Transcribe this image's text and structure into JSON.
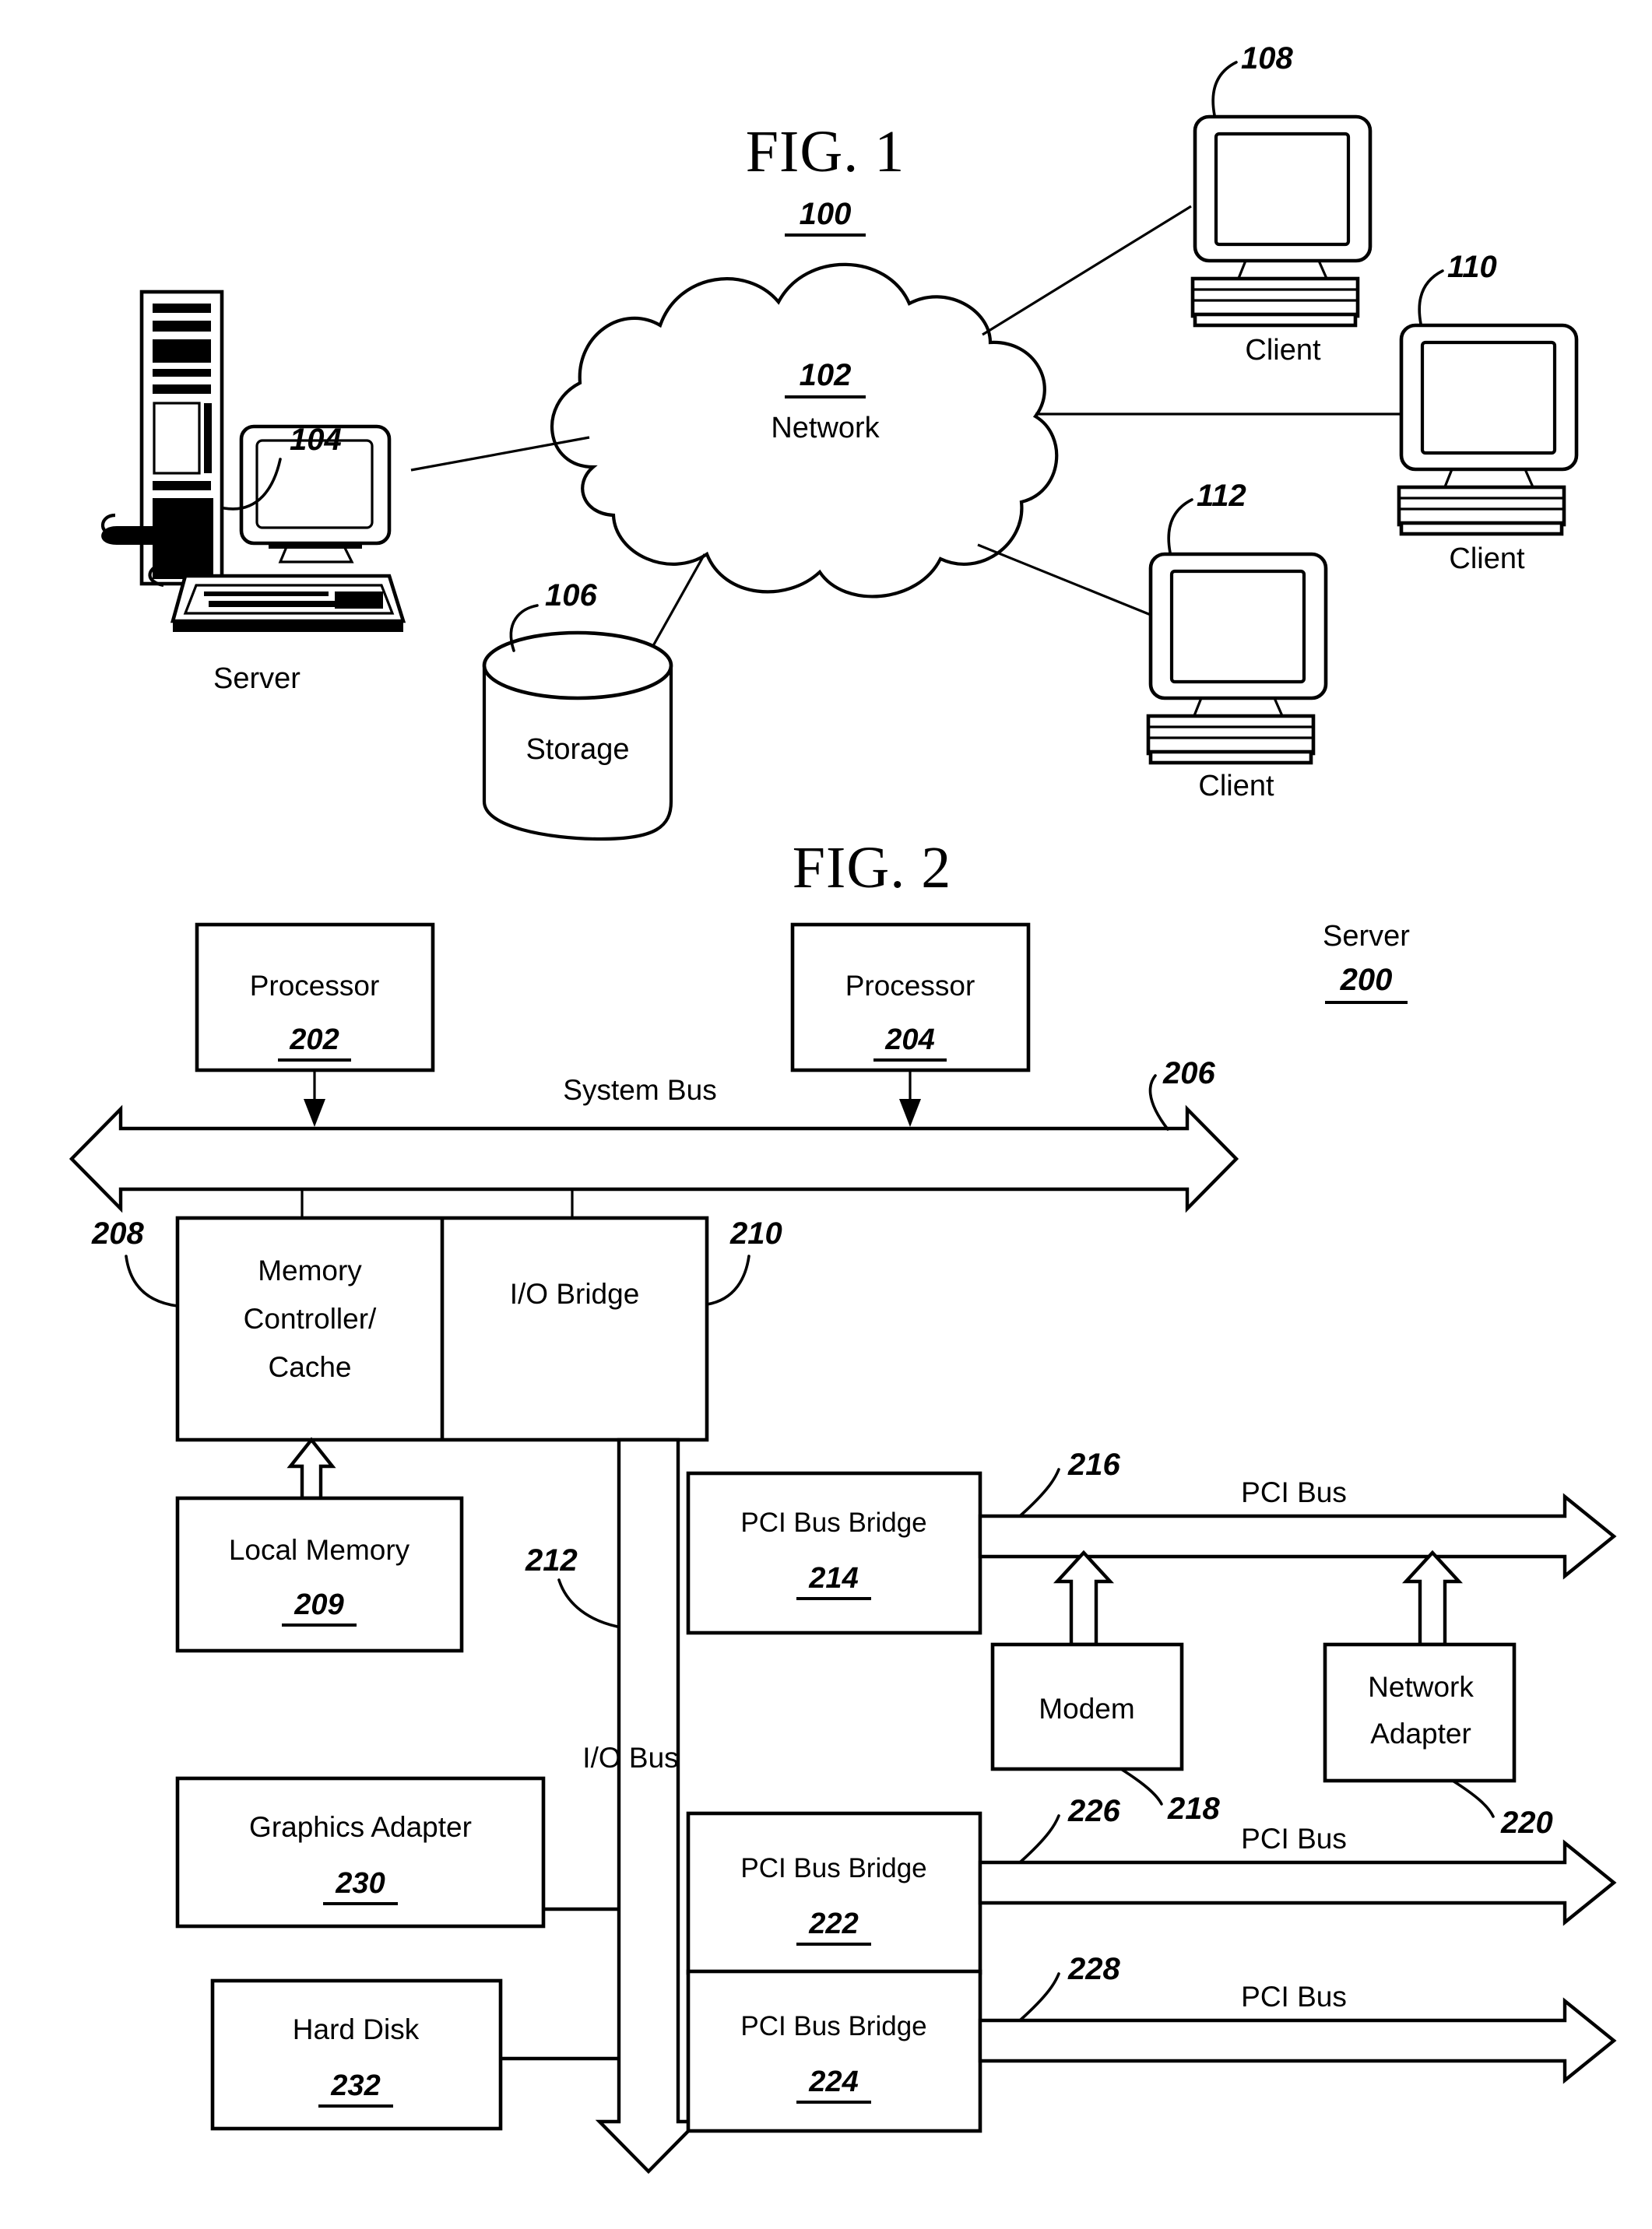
{
  "sheet": {
    "figures": [
      {
        "id": "fig1",
        "title": "FIG. 1",
        "ref": "100"
      },
      {
        "id": "fig2",
        "title": "FIG. 2",
        "ref": "200",
        "ref_label": "Server"
      }
    ]
  },
  "fig1": {
    "title": "FIG. 1",
    "ref": "100",
    "network": {
      "ref": "102",
      "label": "Network"
    },
    "server": {
      "ref": "104",
      "label": "Server"
    },
    "storage": {
      "ref": "106",
      "label": "Storage"
    },
    "clients": [
      {
        "ref": "108",
        "label": "Client"
      },
      {
        "ref": "110",
        "label": "Client"
      },
      {
        "ref": "112",
        "label": "Client"
      }
    ]
  },
  "fig2": {
    "title": "FIG. 2",
    "system_label": "Server",
    "system_ref": "200",
    "blocks": [
      {
        "name": "processor-1",
        "label": "Processor",
        "ref": "202"
      },
      {
        "name": "processor-2",
        "label": "Processor",
        "ref": "204"
      },
      {
        "name": "memory-controller-cache",
        "label_line1": "Memory",
        "label_line2": "Controller/",
        "label_line3": "Cache",
        "ref": "208"
      },
      {
        "name": "io-bridge",
        "label": "I/O Bridge",
        "ref": "210"
      },
      {
        "name": "local-memory",
        "label": "Local Memory",
        "ref": "209"
      },
      {
        "name": "pci-bus-bridge-214",
        "label": "PCI Bus Bridge",
        "ref": "214"
      },
      {
        "name": "modem",
        "label": "Modem",
        "ref": "218"
      },
      {
        "name": "network-adapter",
        "label_line1": "Network",
        "label_line2": "Adapter",
        "ref": "220"
      },
      {
        "name": "graphics-adapter",
        "label": "Graphics Adapter",
        "ref": "230"
      },
      {
        "name": "hard-disk",
        "label": "Hard Disk",
        "ref": "232"
      },
      {
        "name": "pci-bus-bridge-222",
        "label": "PCI Bus Bridge",
        "ref": "222"
      },
      {
        "name": "pci-bus-bridge-224",
        "label": "PCI Bus Bridge",
        "ref": "224"
      }
    ],
    "buses": [
      {
        "name": "system-bus",
        "label": "System Bus",
        "ref": "206"
      },
      {
        "name": "io-bus",
        "label": "I/O Bus",
        "ref": "212"
      },
      {
        "name": "pci-bus-216",
        "label": "PCI Bus",
        "ref": "216"
      },
      {
        "name": "pci-bus-226",
        "label": "PCI Bus",
        "ref": "226"
      },
      {
        "name": "pci-bus-228",
        "label": "PCI Bus",
        "ref": "228"
      }
    ]
  },
  "text": {
    "fig1_title": "FIG. 1",
    "fig1_ref": "100",
    "fig2_title": "FIG. 2",
    "net_ref": "102",
    "net_label": "Network",
    "server_ref": "104",
    "server_label": "Server",
    "storage_ref": "106",
    "storage_label": "Storage",
    "client108_ref": "108",
    "client108_label": "Client",
    "client110_ref": "110",
    "client110_label": "Client",
    "client112_ref": "112",
    "client112_label": "Client",
    "sys_label": "Server",
    "sys_ref": "200",
    "proc1_label": "Processor",
    "proc1_ref": "202",
    "proc2_label": "Processor",
    "proc2_ref": "204",
    "sysbus_label": "System Bus",
    "sysbus_ref": "206",
    "memctl_l1": "Memory",
    "memctl_l2": "Controller/",
    "memctl_l3": "Cache",
    "memctl_ref": "208",
    "iobridge_label": "I/O Bridge",
    "iobridge_ref": "210",
    "localmem_label": "Local Memory",
    "localmem_ref": "209",
    "iobus_label": "I/O Bus",
    "iobus_ref": "212",
    "pcibridge214_label": "PCI Bus Bridge",
    "pcibridge214_ref": "214",
    "pcibus216_label": "PCI Bus",
    "pcibus216_ref": "216",
    "modem_label": "Modem",
    "modem_ref": "218",
    "netadapter_l1": "Network",
    "netadapter_l2": "Adapter",
    "netadapter_ref": "220",
    "gfx_label": "Graphics Adapter",
    "gfx_ref": "230",
    "hdd_label": "Hard Disk",
    "hdd_ref": "232",
    "pcibridge222_label": "PCI Bus Bridge",
    "pcibridge222_ref": "222",
    "pcibus226_label": "PCI Bus",
    "pcibus226_ref": "226",
    "pcibridge224_label": "PCI Bus Bridge",
    "pcibridge224_ref": "224",
    "pcibus228_label": "PCI Bus",
    "pcibus228_ref": "228"
  },
  "colors": {
    "ink": "#000000",
    "paper": "#ffffff"
  }
}
